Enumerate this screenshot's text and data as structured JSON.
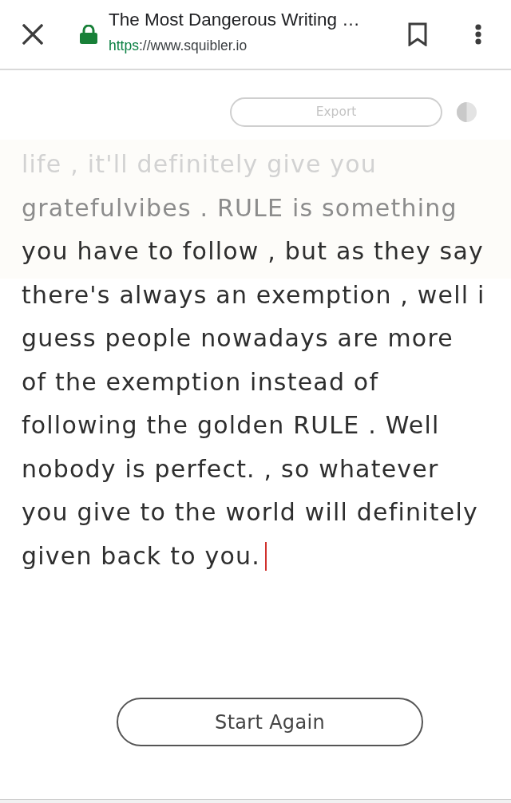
{
  "browser_bar": {
    "page_title": "The Most Dangerous Writing …",
    "url": {
      "scheme": "https",
      "rest": "://www.squibler.io"
    }
  },
  "toolbar": {
    "export_button": {
      "label": "Export",
      "disabled": true
    }
  },
  "editor": {
    "lines": [
      {
        "text": "life , it'll definitely give you",
        "kind": "faint"
      },
      {
        "text": "gratefulvibes . RULE is something",
        "kind": "dim"
      },
      {
        "text": "you have to follow , but as they say",
        "kind": "normal"
      },
      {
        "text": "there's always an exemption , well i",
        "kind": "normal"
      },
      {
        "text": "guess people nowadays are more",
        "kind": "normal"
      },
      {
        "text": "of the exemption instead of",
        "kind": "normal"
      },
      {
        "text": "following the golden RULE . Well",
        "kind": "normal"
      },
      {
        "text": "nobody is perfect. , so whatever",
        "kind": "normal"
      },
      {
        "text": "you give to the world will definitely",
        "kind": "normal"
      },
      {
        "text": "given back to you.",
        "kind": "normal"
      }
    ]
  },
  "start_again_button": {
    "label": "Start Again"
  }
}
